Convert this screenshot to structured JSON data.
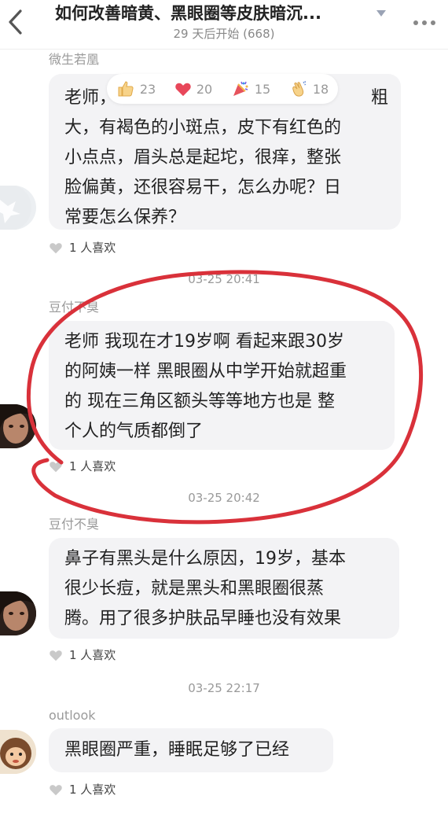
{
  "header": {
    "title": "如何改善暗黄、黑眼圈等皮肤暗沉...",
    "subtitle": "29 天后开始 (668)"
  },
  "reactions": [
    {
      "icon": "thumbs-up-icon",
      "count": "23"
    },
    {
      "icon": "heart-icon",
      "count": "20"
    },
    {
      "icon": "party-popper-icon",
      "count": "15"
    },
    {
      "icon": "clap-icon",
      "count": "18"
    }
  ],
  "messages": [
    {
      "username": "微生若凰",
      "lines": [
        "老师，",
        "大，有褐色的小斑点，皮下有红色的",
        "小点点，眉头总是起坨，很痒，整张",
        "脸偏黄，还很容易干，怎么办呢？日",
        "常要怎么保养？"
      ],
      "line1_tail": "粗",
      "likes": "1 人喜欢"
    },
    {
      "time": "03-25 20:41",
      "username": "豆付不臭",
      "lines": [
        "老师 我现在才19岁啊 看起来跟30岁",
        "的阿姨一样 黑眼圈从中学开始就超重",
        "的 现在三角区额头等等地方也是 整",
        "个人的气质都倒了"
      ],
      "likes": "1 人喜欢"
    },
    {
      "time": "03-25 20:42",
      "username": "豆付不臭",
      "lines": [
        "鼻子有黑头是什么原因，19岁，基本",
        "很少长痘，就是黑头和黑眼圈很蒸",
        "腾。用了很多护肤品早睡也没有效果"
      ],
      "likes": "1 人喜欢"
    },
    {
      "time": "03-25 22:17",
      "username": "outlook",
      "lines": [
        "黑眼圈严重，睡眠足够了已经"
      ],
      "likes": "1 人喜欢"
    }
  ],
  "colors": {
    "annotation_red": "#d9313a",
    "bubble_bg": "#f3f3f5",
    "heart": "#e8475a"
  }
}
